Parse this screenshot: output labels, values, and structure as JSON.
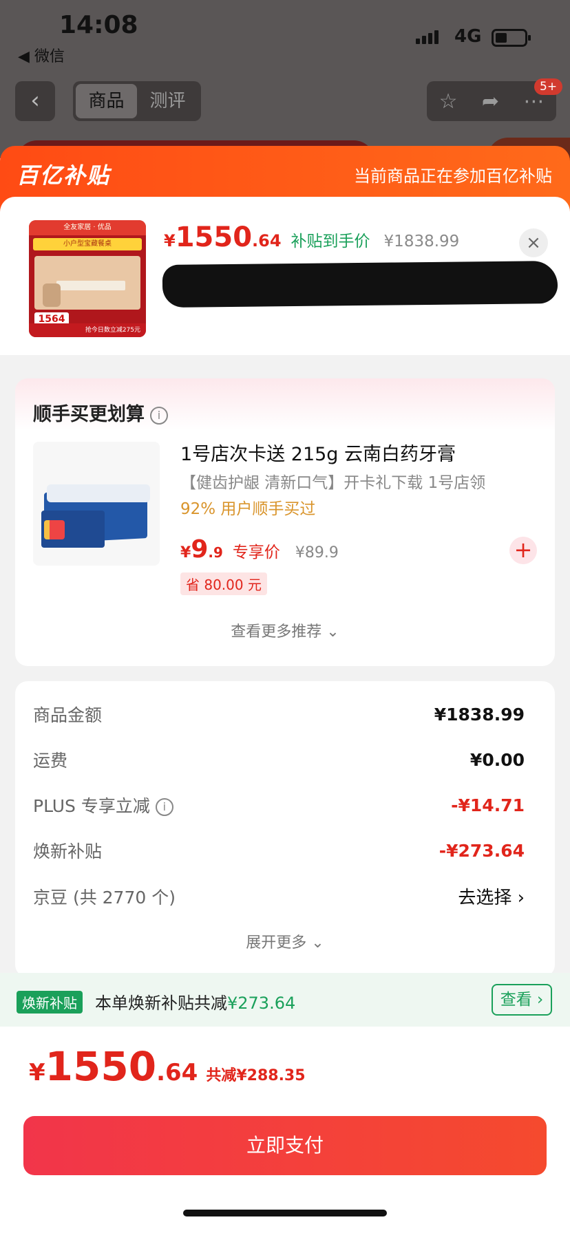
{
  "status_bar": {
    "time": "14:08",
    "back_app": "◀ 微信",
    "network": "4G"
  },
  "nav": {
    "tabs": [
      {
        "label": "商品"
      },
      {
        "label": "测评"
      }
    ],
    "badge": "5+"
  },
  "banner": {
    "logo": "百亿补贴",
    "note": "当前商品正在参加百亿补贴"
  },
  "product": {
    "thumb_text_top": "全友家居 · 优品",
    "thumb_band": "小户型宝藏餐桌",
    "thumb_price": "1564",
    "thumb_bottom": "抢今日数立减275元",
    "price_symbol": "¥",
    "price_int": "1550",
    "price_dec": ".64",
    "price_tag": "补贴到手价",
    "orig_price": "¥1838.99"
  },
  "upsell": {
    "title": "顺手买更划算",
    "name": "1号店次卡送 215g 云南白药牙膏",
    "desc": "【健齿护龈 清新口气】开卡礼下载 1号店领",
    "pct": "92% 用户顺手买过",
    "price_symbol": "¥",
    "price_int": "9",
    "price_dec": ".9",
    "price_label": "专享价",
    "orig_price": "¥89.9",
    "save": "省 80.00 元",
    "more": "查看更多推荐 ⌄"
  },
  "summary": {
    "rows": [
      {
        "label": "商品金额",
        "value": "¥1838.99"
      },
      {
        "label": "运费",
        "value": "¥0.00"
      },
      {
        "label": "PLUS 专享立减",
        "value": "-¥14.71"
      },
      {
        "label": "焕新补贴",
        "value": "-¥273.64"
      },
      {
        "label": "京豆 (共 2770 个)",
        "value": "去选择  ›"
      }
    ],
    "expand": "展开更多 ⌄"
  },
  "renew": {
    "tag": "焕新补贴",
    "text": "本单焕新补贴共减",
    "amount": "¥273.64",
    "view": "查看 ›"
  },
  "pay": {
    "symbol": "¥",
    "int": "1550",
    "dec": ".64",
    "save": "共减¥288.35",
    "button": "立即支付"
  },
  "colors": {
    "accent_red": "#e1251b",
    "banner_orange": "#ff4b14",
    "green": "#1aa05a"
  }
}
